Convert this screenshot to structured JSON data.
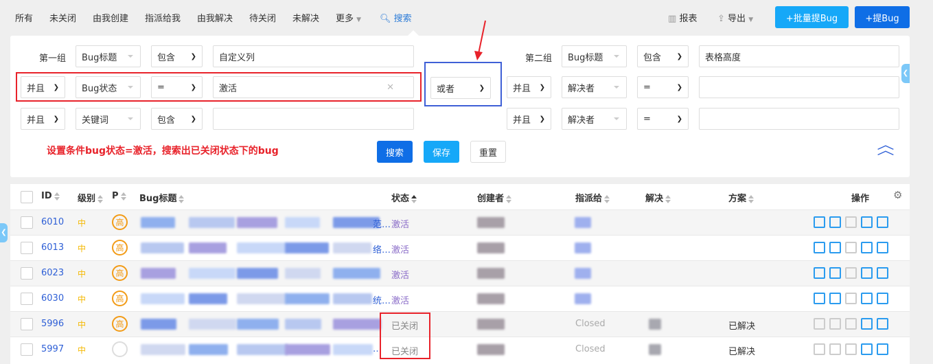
{
  "nav": {
    "items": [
      "所有",
      "未关闭",
      "由我创建",
      "指派给我",
      "由我解决",
      "待关闭",
      "未解决",
      "更多"
    ],
    "search": "搜索"
  },
  "toolbar": {
    "report": "报表",
    "export": "导出",
    "batch_add": "+批量提Bug",
    "add": "+提Bug"
  },
  "search": {
    "group1_label": "第一组",
    "group2_label": "第二组",
    "group1": [
      {
        "logic": "",
        "field": "Bug标题",
        "op": "包含",
        "value": "自定义列"
      },
      {
        "logic": "并且",
        "field": "Bug状态",
        "op": "=",
        "value": "激活"
      },
      {
        "logic": "并且",
        "field": "关键词",
        "op": "包含",
        "value": ""
      }
    ],
    "group_logic": "或者",
    "group2": [
      {
        "logic": "",
        "field": "Bug标题",
        "op": "包含",
        "value": "表格高度"
      },
      {
        "logic": "并且",
        "field": "解决者",
        "op": "=",
        "value": ""
      },
      {
        "logic": "并且",
        "field": "解决者",
        "op": "=",
        "value": ""
      }
    ],
    "annotation": "设置条件bug状态=激活，搜索出已关闭状态下的bug",
    "search_btn": "搜索",
    "save_btn": "保存",
    "reset_btn": "重置"
  },
  "table": {
    "headers": {
      "id": "ID",
      "severity": "级别",
      "pri": "P",
      "title": "Bug标题",
      "status": "状态",
      "creator": "创建者",
      "assigned": "指派给",
      "resolved": "解决",
      "resolution": "方案",
      "actions": "操作"
    },
    "rows": [
      {
        "id": "6010",
        "severity": "中",
        "pri": "高",
        "title_tail": "范…",
        "status": "激活",
        "assigned": "",
        "resolution": ""
      },
      {
        "id": "6013",
        "severity": "中",
        "pri": "高",
        "title_tail": "络…",
        "status": "激活",
        "assigned": "",
        "resolution": ""
      },
      {
        "id": "6023",
        "severity": "中",
        "pri": "高",
        "title_tail": "",
        "status": "激活",
        "assigned": "",
        "resolution": ""
      },
      {
        "id": "6030",
        "severity": "中",
        "pri": "高",
        "title_tail": "统…",
        "status": "激活",
        "assigned": "",
        "resolution": ""
      },
      {
        "id": "5996",
        "severity": "中",
        "pri": "高",
        "title_tail": "",
        "status": "已关闭",
        "assigned": "Closed",
        "resolution": "已解决"
      },
      {
        "id": "5997",
        "severity": "中",
        "pri": "",
        "title_tail": "…",
        "status": "已关闭",
        "assigned": "Closed",
        "resolution": "已解决"
      }
    ]
  },
  "colors": {
    "primary": "#0f6ee6",
    "accent": "#16a8f8",
    "annotation": "#e8222a",
    "highlight_box": "#3e5fd6",
    "status_active": "#8a6cc8"
  }
}
